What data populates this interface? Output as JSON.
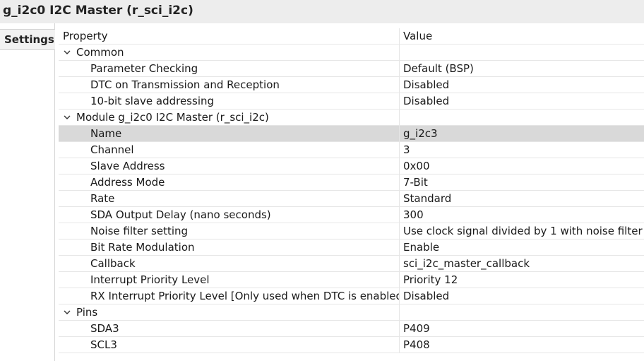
{
  "window": {
    "title": "g_i2c0 I2C Master (r_sci_i2c)"
  },
  "tabs": [
    {
      "label": "Settings"
    }
  ],
  "table": {
    "headers": {
      "property": "Property",
      "value": "Value"
    },
    "rows": [
      {
        "property": "Common",
        "value": "",
        "level": 0,
        "group": true
      },
      {
        "property": "Parameter Checking",
        "value": "Default (BSP)",
        "level": 1
      },
      {
        "property": "DTC on Transmission and Reception",
        "value": "Disabled",
        "level": 1
      },
      {
        "property": "10-bit slave addressing",
        "value": "Disabled",
        "level": 1
      },
      {
        "property": "Module g_i2c0 I2C Master (r_sci_i2c)",
        "value": "",
        "level": 0,
        "group": true
      },
      {
        "property": "Name",
        "value": "g_i2c3",
        "level": 1,
        "selected": true
      },
      {
        "property": "Channel",
        "value": "3",
        "level": 1
      },
      {
        "property": "Slave Address",
        "value": "0x00",
        "level": 1
      },
      {
        "property": "Address Mode",
        "value": "7-Bit",
        "level": 1
      },
      {
        "property": "Rate",
        "value": "Standard",
        "level": 1
      },
      {
        "property": "SDA Output Delay (nano seconds)",
        "value": "300",
        "level": 1
      },
      {
        "property": "Noise filter setting",
        "value": "Use clock signal divided by 1 with noise filter",
        "level": 1
      },
      {
        "property": "Bit Rate Modulation",
        "value": "Enable",
        "level": 1
      },
      {
        "property": "Callback",
        "value": "sci_i2c_master_callback",
        "level": 1
      },
      {
        "property": "Interrupt Priority Level",
        "value": "Priority 12",
        "level": 1
      },
      {
        "property": "RX Interrupt Priority Level [Only used when DTC is enabled]",
        "value": "Disabled",
        "level": 1
      },
      {
        "property": "Pins",
        "value": "",
        "level": 0,
        "group": true
      },
      {
        "property": "SDA3",
        "value": "P409",
        "level": 1
      },
      {
        "property": "SCL3",
        "value": "P408",
        "level": 1
      }
    ]
  },
  "icons": {
    "expanded": "chevron-down-icon"
  },
  "colors": {
    "selected_row": "#d9d9d9",
    "title_bar": "#ededed"
  }
}
